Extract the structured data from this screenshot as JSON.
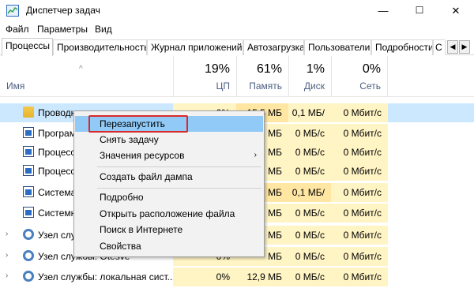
{
  "window": {
    "title": "Диспетчер задач",
    "minimize": "—",
    "maximize": "☐",
    "close": "✕"
  },
  "menu": [
    "Файл",
    "Параметры",
    "Вид"
  ],
  "tabs": [
    "Процессы",
    "Производительность",
    "Журнал приложений",
    "Автозагрузка",
    "Пользователи",
    "Подробности",
    "С"
  ],
  "tab_scroll": {
    "left": "◀",
    "right": "▶"
  },
  "header": {
    "sort_arrow": "^",
    "name_label": "Имя",
    "cpu": {
      "pct": "19%",
      "label": "ЦП"
    },
    "memory": {
      "pct": "61%",
      "label": "Память"
    },
    "disk": {
      "pct": "1%",
      "label": "Диск"
    },
    "network": {
      "pct": "0%",
      "label": "Сеть"
    }
  },
  "rows": [
    {
      "name": "Проводник",
      "cpu": "0%",
      "mem": "15,5 МБ",
      "disk": "0,1 МБ/с",
      "net": "0 Мбит/с",
      "icon": "folder-icon"
    },
    {
      "name": "Програм",
      "cpu": "0%",
      "mem": "МБ",
      "disk": "0 МБ/с",
      "net": "0 Мбит/с",
      "icon": "window-icon"
    },
    {
      "name": "Процесс",
      "cpu": "0%",
      "mem": "МБ",
      "disk": "0 МБ/с",
      "net": "0 Мбит/с",
      "icon": "window-icon"
    },
    {
      "name": "Процесс",
      "cpu": "0%",
      "mem": "МБ",
      "disk": "0 МБ/с",
      "net": "0 Мбит/с",
      "icon": "window-icon"
    },
    {
      "name": "Система",
      "cpu": "0%",
      "mem": "МБ",
      "disk": "0,1 МБ/с",
      "net": "0 Мбит/с",
      "icon": "window-icon"
    },
    {
      "name": "Системн",
      "cpu": "0%",
      "mem": "МБ",
      "disk": "0 МБ/с",
      "net": "0 Мбит/с",
      "icon": "window-icon"
    },
    {
      "name": "Узел служб",
      "cpu": "0%",
      "mem": "МБ",
      "disk": "0 МБ/с",
      "net": "0 Мбит/с",
      "icon": "gear-icon"
    },
    {
      "name": "Узел службы: Otesve",
      "cpu": "0%",
      "mem": "МБ",
      "disk": "0 МБ/с",
      "net": "0 Мбит/с",
      "icon": "gear-icon"
    },
    {
      "name": "Узел службы: локальная сист...",
      "cpu": "0%",
      "mem": "12,9 МБ",
      "disk": "0 МБ/с",
      "net": "0 Мбит/с",
      "icon": "gear-icon"
    }
  ],
  "context_menu": {
    "restart": "Перезапустить",
    "end_task": "Снять задачу",
    "resource_values": "Значения ресурсов",
    "create_dump": "Создать файл дампа",
    "details": "Подробно",
    "open_location": "Открыть расположение файла",
    "search_online": "Поиск в Интернете",
    "properties": "Свойства",
    "submenu_arrow": "›"
  },
  "colors": {
    "selected_row": "#cce8ff",
    "heat": "#fff4c4",
    "menu_highlight": "#91c9f7",
    "callout": "#d92a2a"
  }
}
